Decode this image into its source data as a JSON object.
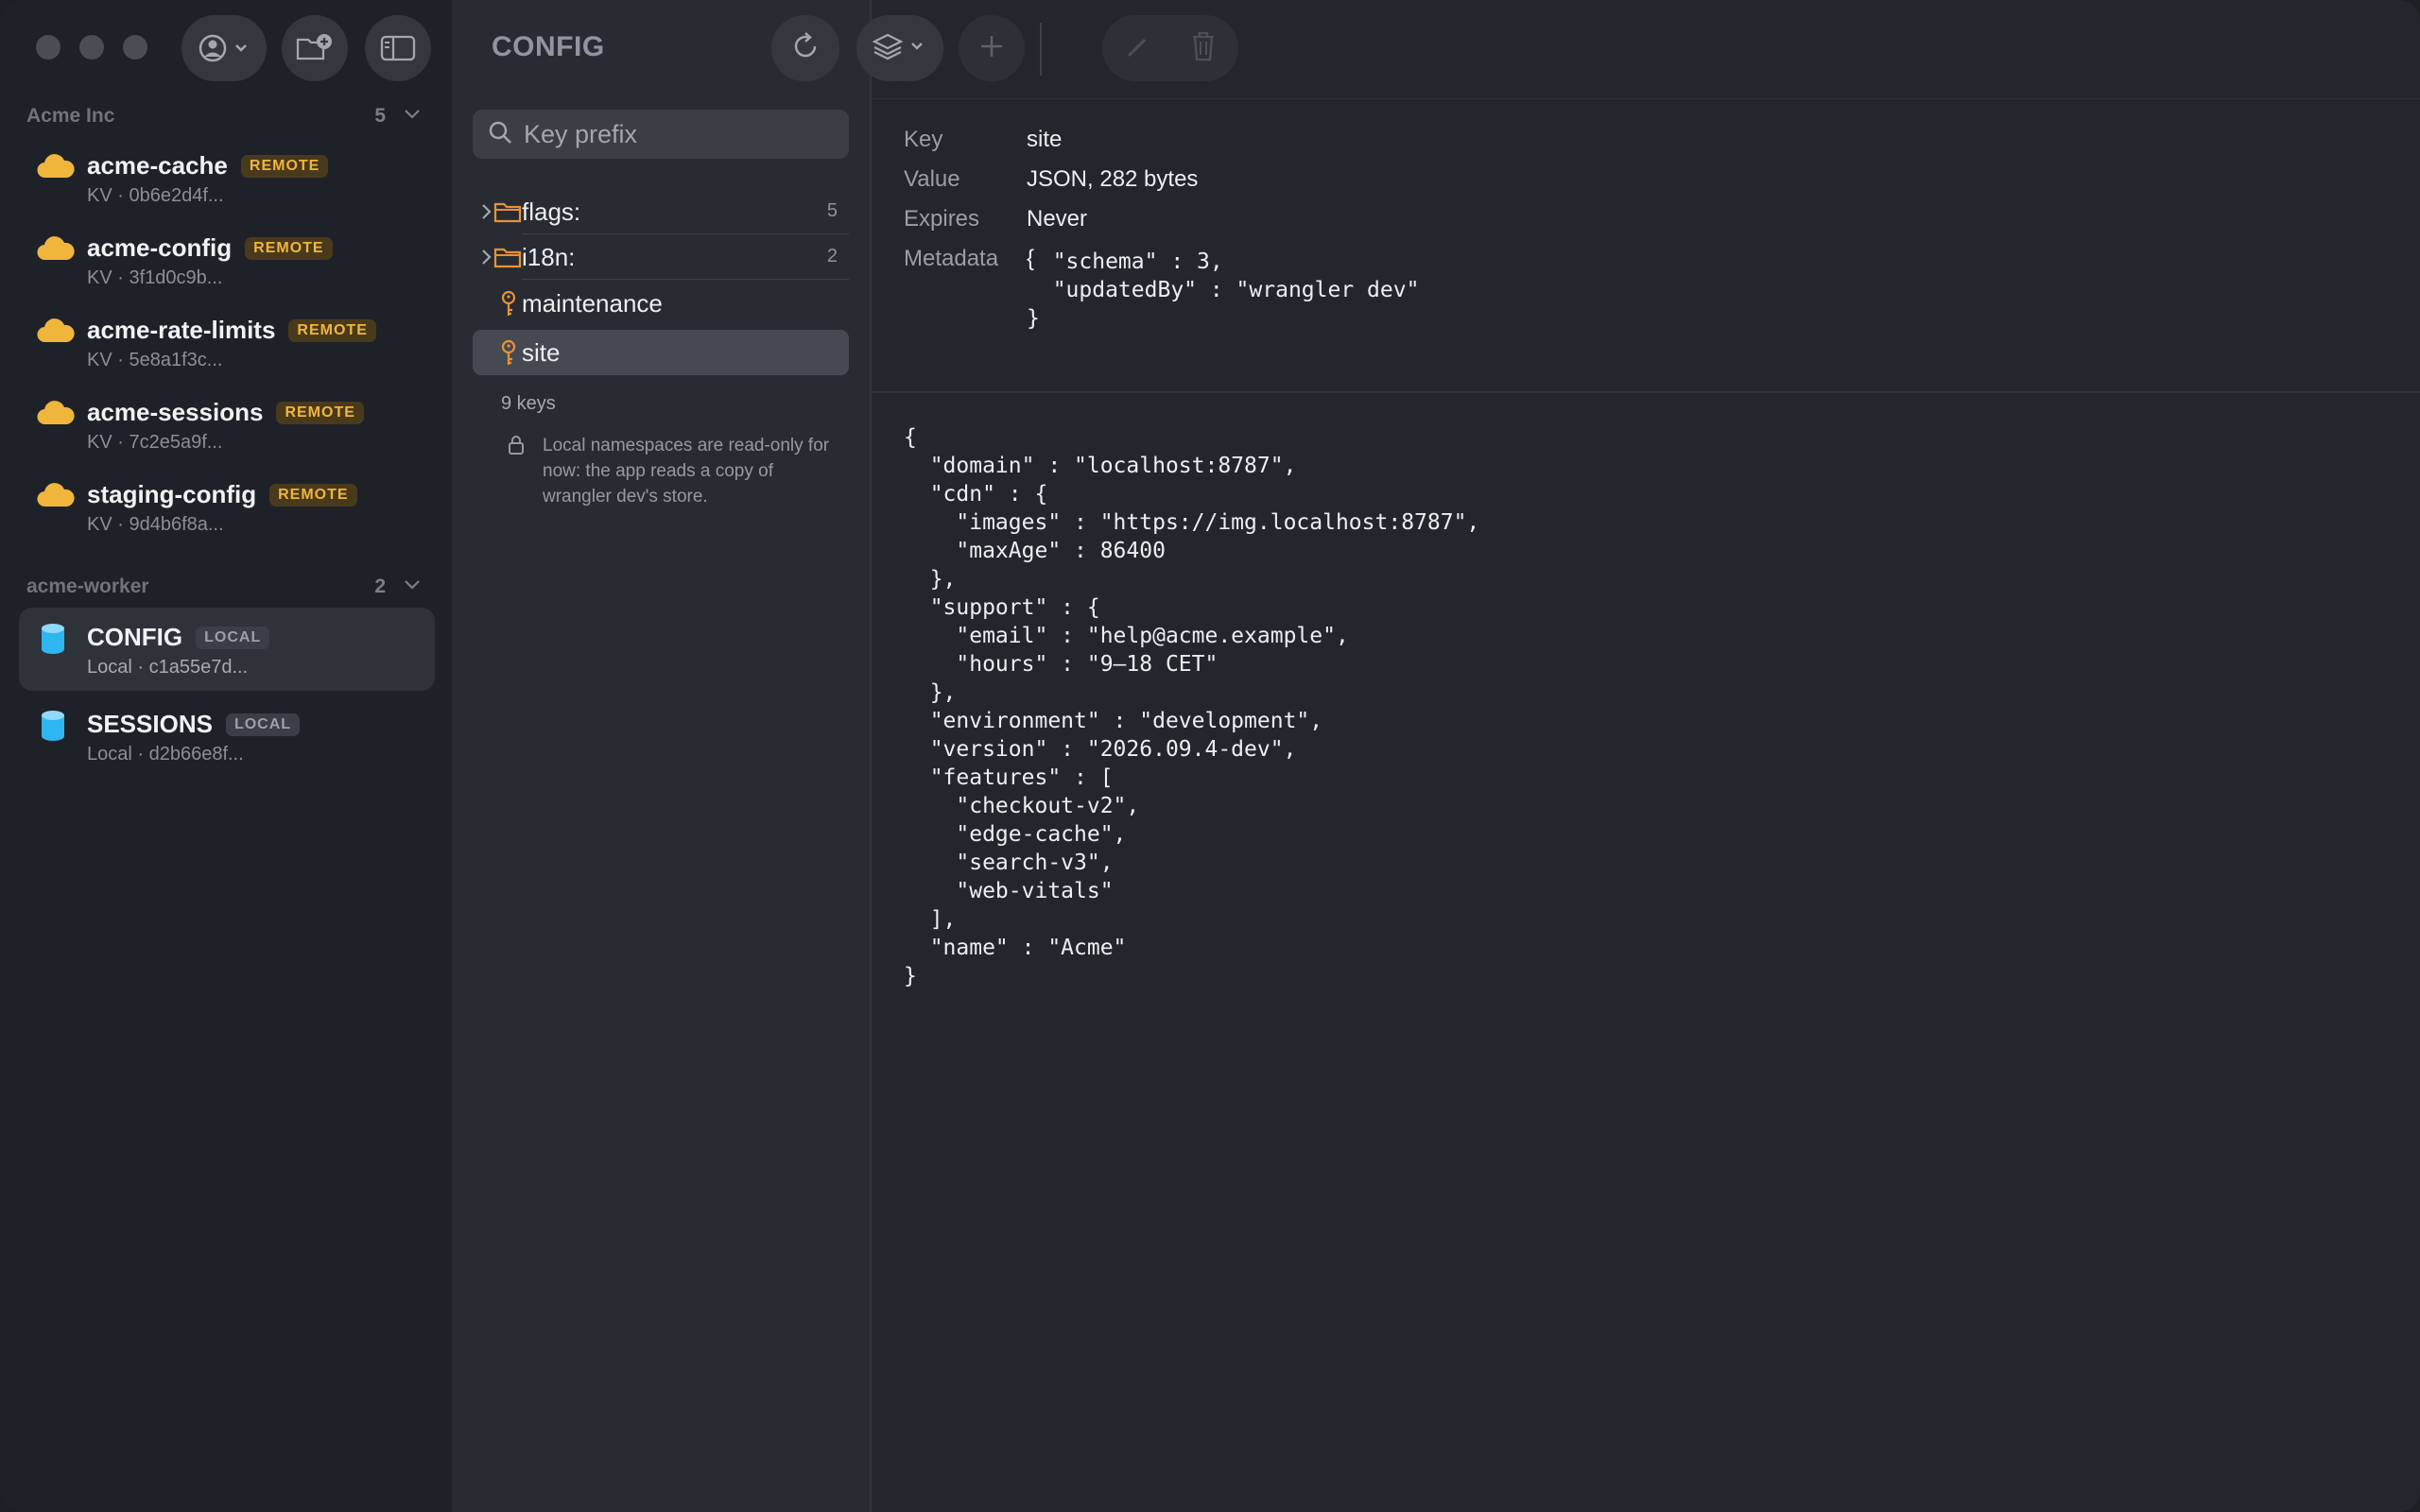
{
  "window": {
    "title": "CONFIG"
  },
  "sidebar": {
    "sections": [
      {
        "name": "Acme Inc",
        "count": "5"
      },
      {
        "name": "acme-worker",
        "count": "2"
      }
    ],
    "remote_namespaces": [
      {
        "name": "acme-cache",
        "badge": "REMOTE",
        "sub": "KV · 0b6e2d4f..."
      },
      {
        "name": "acme-config",
        "badge": "REMOTE",
        "sub": "KV · 3f1d0c9b..."
      },
      {
        "name": "acme-rate-limits",
        "badge": "REMOTE",
        "sub": "KV · 5e8a1f3c..."
      },
      {
        "name": "acme-sessions",
        "badge": "REMOTE",
        "sub": "KV · 7c2e5a9f..."
      },
      {
        "name": "staging-config",
        "badge": "REMOTE",
        "sub": "KV · 9d4b6f8a..."
      }
    ],
    "local_namespaces": [
      {
        "name": "CONFIG",
        "badge": "LOCAL",
        "sub": "Local · c1a55e7d...",
        "selected": true
      },
      {
        "name": "SESSIONS",
        "badge": "LOCAL",
        "sub": "Local · d2b66e8f..."
      }
    ]
  },
  "keys": {
    "search": {
      "placeholder": "Key prefix"
    },
    "items": [
      {
        "label": "flags:",
        "type": "folder",
        "count": "5"
      },
      {
        "label": "i18n:",
        "type": "folder",
        "count": "2"
      },
      {
        "label": "maintenance",
        "type": "key"
      },
      {
        "label": "site",
        "type": "key",
        "selected": true
      }
    ],
    "total": "9 keys",
    "note": "Local namespaces are read-only for now: the app reads a copy of wrangler dev's store."
  },
  "detail": {
    "fields": [
      {
        "label": "Key",
        "value": "site"
      },
      {
        "label": "Value",
        "value": "JSON, 282 bytes"
      },
      {
        "label": "Expires",
        "value": "Never"
      },
      {
        "label": "Metadata",
        "value": "{"
      }
    ],
    "metadata_json": "  \"schema\" : 3,\n  \"updatedBy\" : \"wrangler dev\"\n}",
    "value_json": "{\n  \"domain\" : \"localhost:8787\",\n  \"cdn\" : {\n    \"images\" : \"https://img.localhost:8787\",\n    \"maxAge\" : 86400\n  },\n  \"support\" : {\n    \"email\" : \"help@acme.example\",\n    \"hours\" : \"9–18 CET\"\n  },\n  \"environment\" : \"development\",\n  \"version\" : \"2026.09.4-dev\",\n  \"features\" : [\n    \"checkout-v2\",\n    \"edge-cache\",\n    \"search-v3\",\n    \"web-vitals\"\n  ],\n  \"name\" : \"Acme\"\n}"
  },
  "colors": {
    "accent_remote": "#f0b53b",
    "accent_local": "#2fb5f0",
    "folder": "#e8913a"
  },
  "icons": [
    "account-icon",
    "new-folder-icon",
    "sidebar-toggle-icon",
    "refresh-icon",
    "layers-icon",
    "add-icon",
    "edit-icon",
    "trash-icon",
    "cloud-icon",
    "database-icon",
    "folder-icon",
    "key-icon",
    "search-icon",
    "lock-icon"
  ]
}
